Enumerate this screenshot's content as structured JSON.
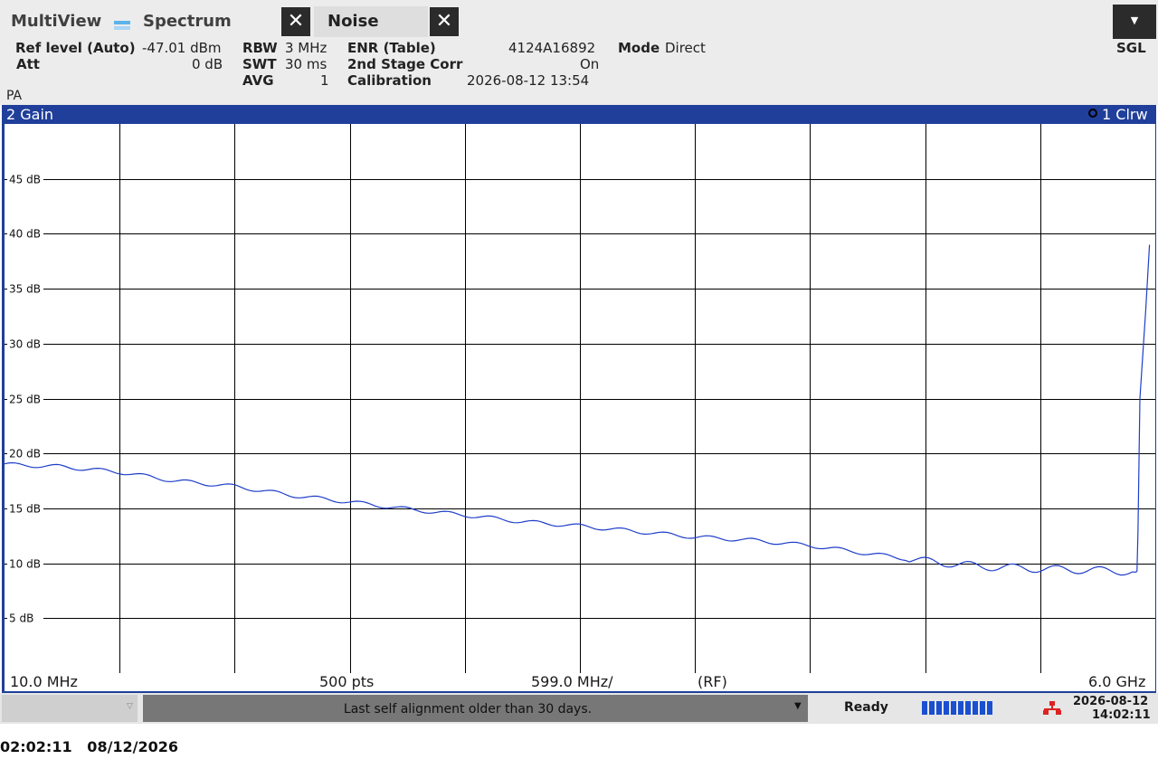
{
  "tabs": {
    "multiview": "MultiView",
    "spectrum": "Spectrum",
    "noise": "Noise"
  },
  "settings": {
    "ref_level_label": "Ref level (Auto)",
    "ref_level_value": "-47.01 dBm",
    "att_label": "Att",
    "att_value": "0 dB",
    "rbw_label": "RBW",
    "rbw_value": "3 MHz",
    "swt_label": "SWT",
    "swt_value": "30 ms",
    "avg_label": "AVG",
    "avg_value": "1",
    "enr_label": "ENR (Table)",
    "enr_value": "4124A16892",
    "stage_label": "2nd Stage Corr",
    "stage_value": "On",
    "cal_label": "Calibration",
    "cal_value": "2026-08-12 13:54",
    "mode_label": "Mode",
    "mode_value": "Direct",
    "sgl": "SGL",
    "pa": "PA"
  },
  "window": {
    "title": "2 Gain",
    "trace_label": "1 Clrw"
  },
  "xaxis": {
    "start": "10.0 MHz",
    "pts": "500 pts",
    "step": "599.0 MHz/",
    "rf": "(RF)",
    "stop": "6.0 GHz"
  },
  "status": {
    "message": "Last self alignment older than 30 days.",
    "ready": "Ready",
    "date": "2026-08-12",
    "time": "14:02:11"
  },
  "footer": {
    "clock": "02:02:11   08/12/2026"
  },
  "colors": {
    "accent": "#1f3f9a",
    "trace": "#1f3fc8",
    "progress": "#1a4fd0"
  },
  "chart_data": {
    "type": "line",
    "title": "2 Gain",
    "xlabel": "",
    "ylabel": "",
    "x_range_mhz": [
      10,
      6000
    ],
    "ylim": [
      0,
      50
    ],
    "y_ticks": [
      5,
      10,
      15,
      20,
      25,
      30,
      35,
      40,
      45
    ],
    "y_tick_labels": [
      "5 dB",
      "10 dB",
      "15 dB",
      "20 dB",
      "25 dB",
      "30 dB",
      "35 dB",
      "40 dB",
      "45 dB"
    ],
    "grid": true,
    "legend": "top-right",
    "series": [
      {
        "name": "1 Clrw",
        "x": [
          10,
          300,
          610,
          900,
          1210,
          1500,
          1800,
          2120,
          2400,
          2700,
          3000,
          3300,
          3600,
          3900,
          4210,
          4500,
          4800,
          5100,
          5400,
          5800,
          5900,
          5905,
          5910,
          5920,
          5950,
          5970
        ],
        "y": [
          19.0,
          18.8,
          18.3,
          17.5,
          17.0,
          16.2,
          15.6,
          14.9,
          14.4,
          13.8,
          13.4,
          12.9,
          12.4,
          12.1,
          11.6,
          10.9,
          10.2,
          9.7,
          9.5,
          9.3,
          9.2,
          9.3,
          13.0,
          25.0,
          33.0,
          39.0
        ]
      }
    ]
  }
}
